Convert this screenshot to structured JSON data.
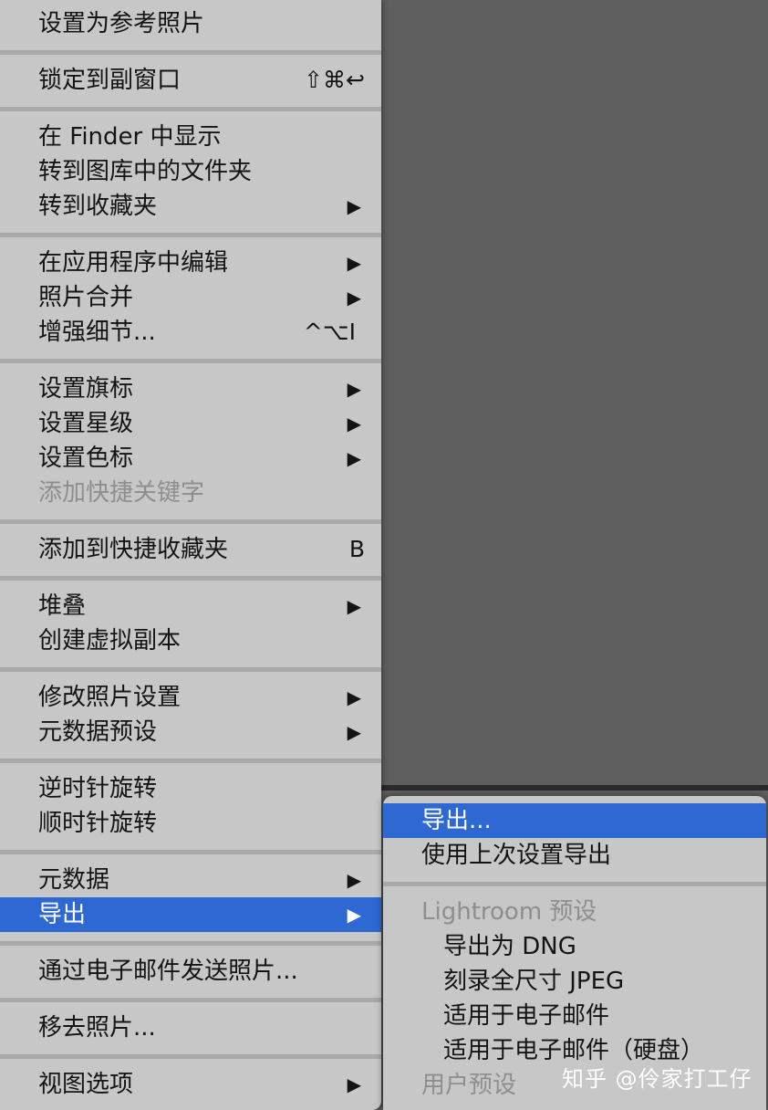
{
  "menu": {
    "items": [
      {
        "label": "设置为参考照片"
      },
      {
        "label": "锁定到副窗口",
        "shortcut": "⇧⌘↩"
      },
      {
        "label": "在 Finder 中显示"
      },
      {
        "label": "转到图库中的文件夹"
      },
      {
        "label": "转到收藏夹",
        "arrow": "▶"
      },
      {
        "label": "在应用程序中编辑",
        "arrow": "▶"
      },
      {
        "label": "照片合并",
        "arrow": "▶"
      },
      {
        "label": "增强细节...",
        "shortcut": "^⌥I"
      },
      {
        "label": "设置旗标",
        "arrow": "▶"
      },
      {
        "label": "设置星级",
        "arrow": "▶"
      },
      {
        "label": "设置色标",
        "arrow": "▶"
      },
      {
        "label": "添加快捷关键字",
        "disabled": true
      },
      {
        "label": "添加到快捷收藏夹",
        "shortcut": "B"
      },
      {
        "label": "堆叠",
        "arrow": "▶"
      },
      {
        "label": "创建虚拟副本"
      },
      {
        "label": "修改照片设置",
        "arrow": "▶"
      },
      {
        "label": "元数据预设",
        "arrow": "▶"
      },
      {
        "label": "逆时针旋转"
      },
      {
        "label": "顺时针旋转"
      },
      {
        "label": "元数据",
        "arrow": "▶"
      },
      {
        "label": "导出",
        "arrow": "▶",
        "highlighted": true
      },
      {
        "label": "通过电子邮件发送照片..."
      },
      {
        "label": "移去照片..."
      },
      {
        "label": "视图选项",
        "arrow": "▶"
      }
    ]
  },
  "submenu": {
    "items": [
      {
        "label": "导出...",
        "highlighted": true
      },
      {
        "label": "使用上次设置导出"
      },
      {
        "label": "Lightroom 预设",
        "disabled": true
      },
      {
        "label": "导出为 DNG"
      },
      {
        "label": "刻录全尺寸 JPEG"
      },
      {
        "label": "适用于电子邮件"
      },
      {
        "label": "适用于电子邮件（硬盘）"
      },
      {
        "label": "用户预设",
        "disabled": true
      }
    ]
  },
  "watermark": "知乎 @伶家打工仔",
  "colors": {
    "menu_bg": "#c7c7c7",
    "highlight": "#2d68d3",
    "disabled_text": "#8e8e8e",
    "background": "#5f5f5f"
  }
}
